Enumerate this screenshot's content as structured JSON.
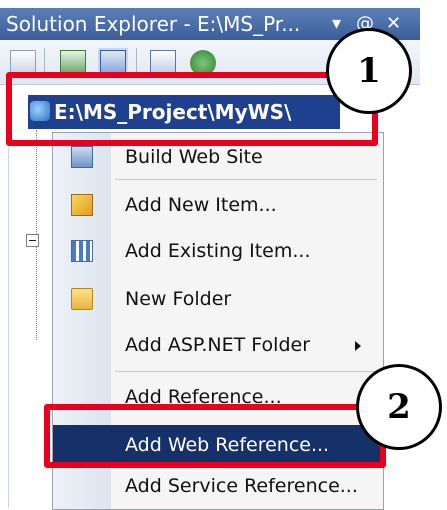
{
  "window": {
    "title": "Solution Explorer - E:\\MS_Pr...",
    "pin_glyph": "▾",
    "dock_glyph": "@",
    "close_glyph": "✕"
  },
  "toolbar": {
    "icons": [
      "properties-icon",
      "refresh-icon",
      "nest-files-icon",
      "view-code-icon",
      "web-configuration-icon"
    ]
  },
  "tree": {
    "root_label": "E:\\MS_Project\\MyWS\\",
    "expander_glyph": "−"
  },
  "context_menu": {
    "items": [
      {
        "label": "Build Web Site",
        "icon": "build-icon"
      },
      {
        "label": "Add New Item...",
        "icon": "add-new-item-icon"
      },
      {
        "label": "Add Existing Item...",
        "icon": "add-existing-item-icon"
      },
      {
        "label": "New Folder",
        "icon": "new-folder-icon"
      },
      {
        "label": "Add ASP.NET Folder",
        "icon": "",
        "submenu": true
      },
      {
        "label": "Add Reference...",
        "icon": ""
      },
      {
        "label": "Add Web Reference...",
        "icon": "",
        "selected": true
      },
      {
        "label": "Add Service Reference...",
        "icon": ""
      }
    ]
  },
  "annotations": {
    "callout_1": "1",
    "callout_2": "2",
    "color": "#e8001c"
  }
}
